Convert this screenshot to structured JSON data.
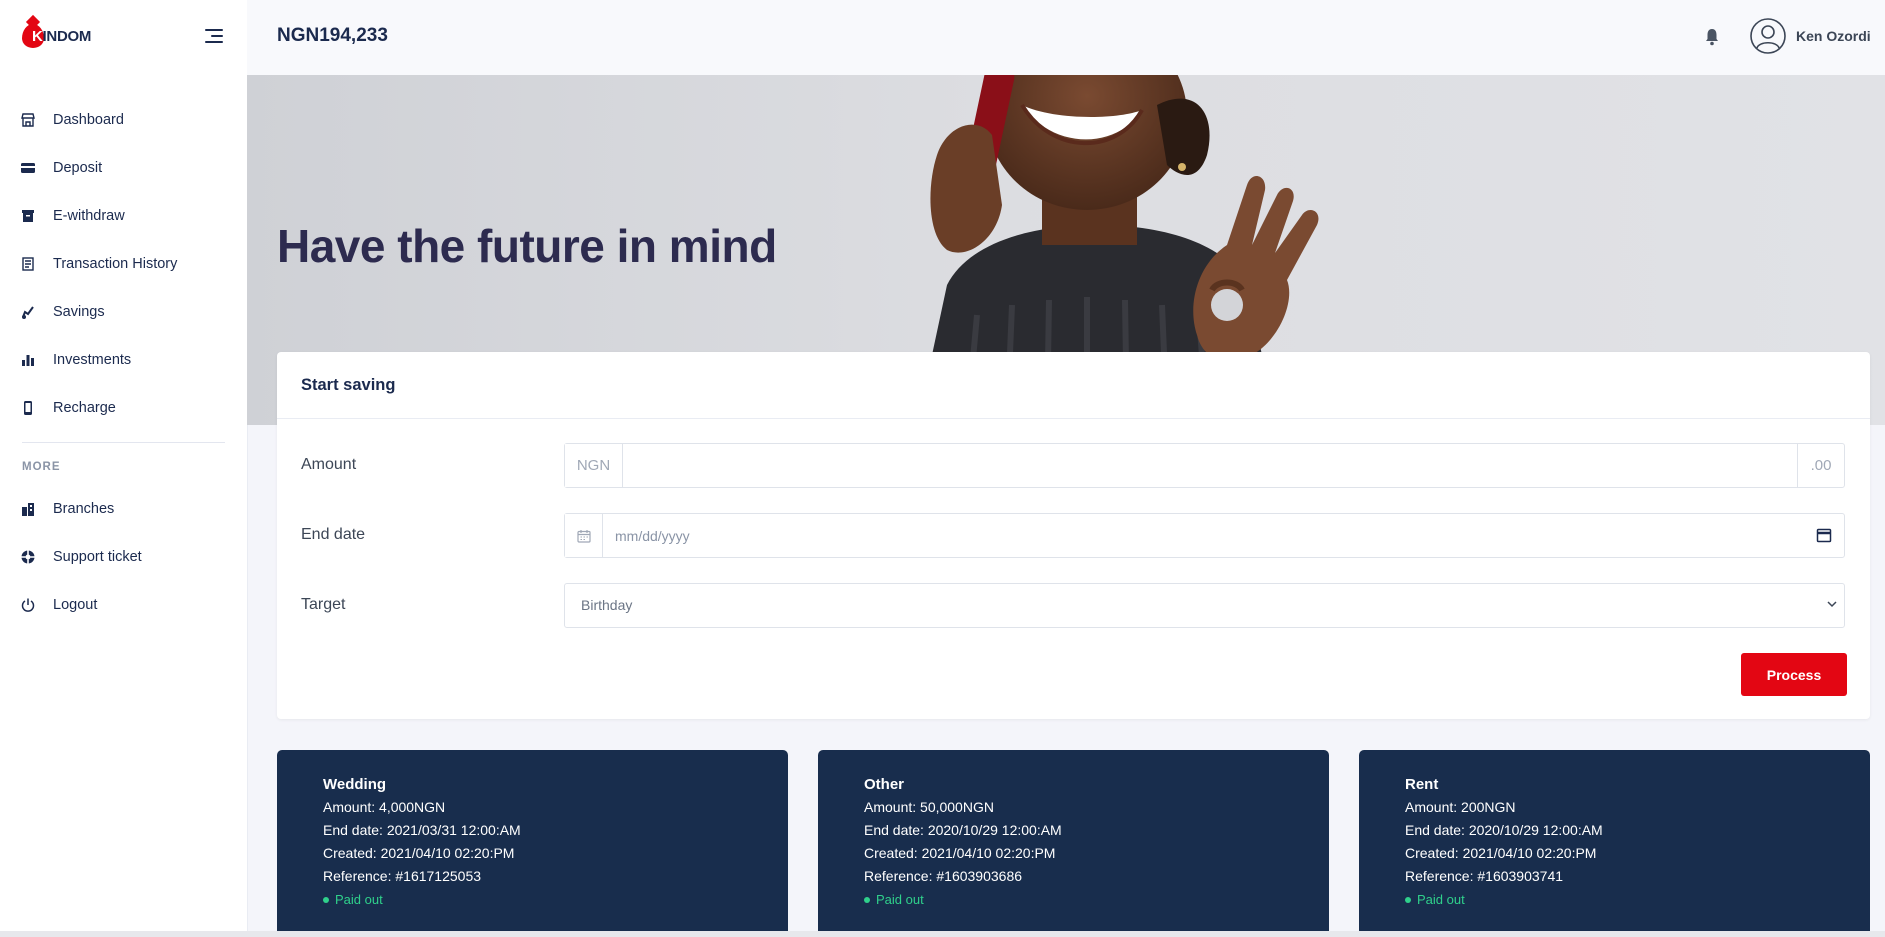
{
  "brand": {
    "name": "KINDOM",
    "initial": "K",
    "name_rest": "INDOM"
  },
  "sidebar": {
    "items": [
      {
        "label": "Dashboard",
        "icon": "store-icon"
      },
      {
        "label": "Deposit",
        "icon": "credit-card-icon"
      },
      {
        "label": "E-withdraw",
        "icon": "archive-icon"
      },
      {
        "label": "Transaction History",
        "icon": "receipt-icon"
      },
      {
        "label": "Savings",
        "icon": "piggy-bank-icon"
      },
      {
        "label": "Investments",
        "icon": "bar-chart-icon"
      },
      {
        "label": "Recharge",
        "icon": "mobile-icon"
      }
    ],
    "more_heading": "MORE",
    "more_items": [
      {
        "label": "Branches",
        "icon": "building-icon"
      },
      {
        "label": "Support ticket",
        "icon": "lifebuoy-icon"
      },
      {
        "label": "Logout",
        "icon": "power-icon"
      }
    ]
  },
  "header": {
    "balance": "NGN194,233",
    "user_name": "Ken Ozordi"
  },
  "hero": {
    "title": "Have the future in mind"
  },
  "form": {
    "title": "Start saving",
    "amount_label": "Amount",
    "amount_prefix": "NGN",
    "amount_suffix": ".00",
    "amount_value": "",
    "end_date_label": "End date",
    "end_date_placeholder": "mm/dd/yyyy",
    "target_label": "Target",
    "target_selected": "Birthday",
    "submit_label": "Process"
  },
  "plans": [
    {
      "name": "Wedding",
      "amount": "Amount: 4,000NGN",
      "end_date": "End date: 2021/03/31 12:00:AM",
      "created": "Created: 2021/04/10 02:20:PM",
      "reference": "Reference: #1617125053",
      "status": "Paid out"
    },
    {
      "name": "Other",
      "amount": "Amount: 50,000NGN",
      "end_date": "End date: 2020/10/29 12:00:AM",
      "created": "Created: 2021/04/10 02:20:PM",
      "reference": "Reference: #1603903686",
      "status": "Paid out"
    },
    {
      "name": "Rent",
      "amount": "Amount: 200NGN",
      "end_date": "End date: 2020/10/29 12:00:AM",
      "created": "Created: 2021/04/10 02:20:PM",
      "reference": "Reference: #1603903741",
      "status": "Paid out"
    }
  ],
  "colors": {
    "accent": "#e30613",
    "navy": "#182d4d",
    "status_green": "#2fd08b"
  }
}
